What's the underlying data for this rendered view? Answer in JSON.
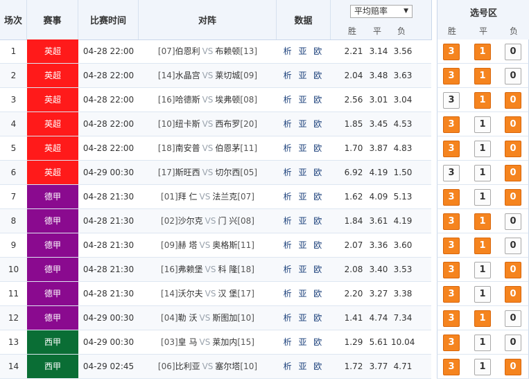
{
  "header": {
    "col_index": "场次",
    "col_league": "赛事",
    "col_time": "比赛时间",
    "col_match": "对阵",
    "col_data": "数据",
    "odds_select": "平均赔率",
    "odds_win": "胜",
    "odds_draw": "平",
    "odds_loss": "负",
    "select_title": "选号区",
    "sel_win": "胜",
    "sel_draw": "平",
    "sel_loss": "负"
  },
  "colors": {
    "epl": "#ff1a1a",
    "bundesliga": "#8a0a8f",
    "laliga": "#0a6e35",
    "pick_on": "#f5841f"
  },
  "pick_labels": [
    "3",
    "1",
    "0"
  ],
  "data_link_text": "析 亚 欧",
  "vs_text": "VS",
  "rows": [
    {
      "idx": "1",
      "league": "英超",
      "league_key": "epl",
      "time": "04-28 22:00",
      "home_rank": "[07]",
      "home": "伯恩利",
      "away": "布赖顿",
      "away_rank": "[13]",
      "win": "2.21",
      "draw": "3.14",
      "loss": "3.56",
      "picks": [
        true,
        true,
        false
      ]
    },
    {
      "idx": "2",
      "league": "英超",
      "league_key": "epl",
      "time": "04-28 22:00",
      "home_rank": "[14]",
      "home": "水晶宫",
      "away": "莱切城",
      "away_rank": "[09]",
      "win": "2.04",
      "draw": "3.48",
      "loss": "3.63",
      "picks": [
        true,
        true,
        false
      ]
    },
    {
      "idx": "3",
      "league": "英超",
      "league_key": "epl",
      "time": "04-28 22:00",
      "home_rank": "[16]",
      "home": "哈德斯",
      "away": "埃弗顿",
      "away_rank": "[08]",
      "win": "2.56",
      "draw": "3.01",
      "loss": "3.04",
      "picks": [
        false,
        true,
        true
      ]
    },
    {
      "idx": "4",
      "league": "英超",
      "league_key": "epl",
      "time": "04-28 22:00",
      "home_rank": "[10]",
      "home": "纽卡斯",
      "away": "西布罗",
      "away_rank": "[20]",
      "win": "1.85",
      "draw": "3.45",
      "loss": "4.53",
      "picks": [
        true,
        false,
        true
      ]
    },
    {
      "idx": "5",
      "league": "英超",
      "league_key": "epl",
      "time": "04-28 22:00",
      "home_rank": "[18]",
      "home": "南安普",
      "away": "伯恩茅",
      "away_rank": "[11]",
      "win": "1.70",
      "draw": "3.87",
      "loss": "4.83",
      "picks": [
        true,
        false,
        true
      ]
    },
    {
      "idx": "6",
      "league": "英超",
      "league_key": "epl",
      "time": "04-29 00:30",
      "home_rank": "[17]",
      "home": "斯旺西",
      "away": "切尔西",
      "away_rank": "[05]",
      "win": "6.92",
      "draw": "4.19",
      "loss": "1.50",
      "picks": [
        false,
        false,
        true
      ]
    },
    {
      "idx": "7",
      "league": "德甲",
      "league_key": "bundesliga",
      "time": "04-28 21:30",
      "home_rank": "[01]",
      "home": "拜 仁",
      "away": "法兰克",
      "away_rank": "[07]",
      "win": "1.62",
      "draw": "4.09",
      "loss": "5.13",
      "picks": [
        true,
        false,
        true
      ]
    },
    {
      "idx": "8",
      "league": "德甲",
      "league_key": "bundesliga",
      "time": "04-28 21:30",
      "home_rank": "[02]",
      "home": "沙尔克",
      "away": "门 兴",
      "away_rank": "[08]",
      "win": "1.84",
      "draw": "3.61",
      "loss": "4.19",
      "picks": [
        true,
        true,
        false
      ]
    },
    {
      "idx": "9",
      "league": "德甲",
      "league_key": "bundesliga",
      "time": "04-28 21:30",
      "home_rank": "[09]",
      "home": "赫 塔",
      "away": "奥格斯",
      "away_rank": "[11]",
      "win": "2.07",
      "draw": "3.36",
      "loss": "3.60",
      "picks": [
        true,
        true,
        false
      ]
    },
    {
      "idx": "10",
      "league": "德甲",
      "league_key": "bundesliga",
      "time": "04-28 21:30",
      "home_rank": "[16]",
      "home": "弗赖堡",
      "away": "科 隆",
      "away_rank": "[18]",
      "win": "2.08",
      "draw": "3.40",
      "loss": "3.53",
      "picks": [
        true,
        false,
        true
      ]
    },
    {
      "idx": "11",
      "league": "德甲",
      "league_key": "bundesliga",
      "time": "04-28 21:30",
      "home_rank": "[14]",
      "home": "沃尔夫",
      "away": "汉 堡",
      "away_rank": "[17]",
      "win": "2.20",
      "draw": "3.27",
      "loss": "3.38",
      "picks": [
        true,
        false,
        true
      ]
    },
    {
      "idx": "12",
      "league": "德甲",
      "league_key": "bundesliga",
      "time": "04-29 00:30",
      "home_rank": "[04]",
      "home": "勒 沃",
      "away": "斯图加",
      "away_rank": "[10]",
      "win": "1.41",
      "draw": "4.74",
      "loss": "7.34",
      "picks": [
        true,
        true,
        false
      ]
    },
    {
      "idx": "13",
      "league": "西甲",
      "league_key": "laliga",
      "time": "04-29 00:30",
      "home_rank": "[03]",
      "home": "皇 马",
      "away": "莱加内",
      "away_rank": "[15]",
      "win": "1.29",
      "draw": "5.61",
      "loss": "10.04",
      "picks": [
        true,
        false,
        false
      ]
    },
    {
      "idx": "14",
      "league": "西甲",
      "league_key": "laliga",
      "time": "04-29 02:45",
      "home_rank": "[06]",
      "home": "比利亚",
      "away": "塞尔塔",
      "away_rank": "[10]",
      "win": "1.72",
      "draw": "3.77",
      "loss": "4.71",
      "picks": [
        true,
        false,
        true
      ]
    }
  ]
}
